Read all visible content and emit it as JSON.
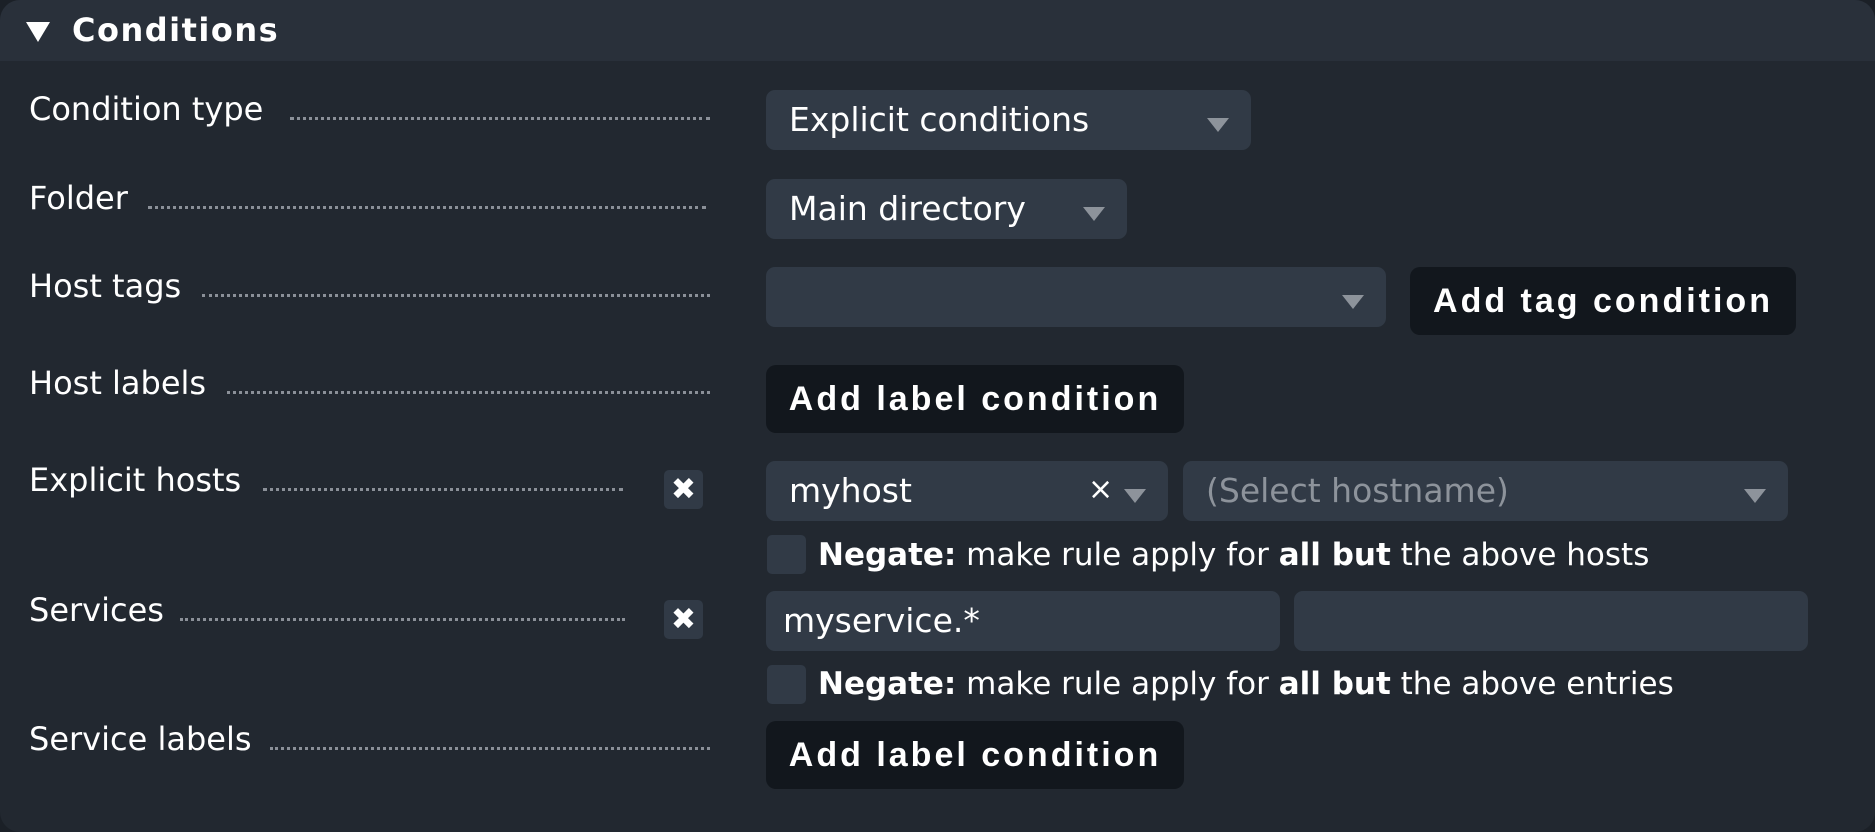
{
  "section": {
    "title": "Conditions",
    "collapse_icon": "triangle-down-icon"
  },
  "rows": {
    "condition_type": {
      "label": "Condition type",
      "selected": "Explicit conditions"
    },
    "folder": {
      "label": "Folder",
      "selected": "Main directory"
    },
    "host_tags": {
      "label": "Host tags",
      "selected": "",
      "button": "Add tag condition"
    },
    "host_labels": {
      "label": "Host labels",
      "button": "Add label condition"
    },
    "explicit_hosts": {
      "label": "Explicit hosts",
      "delete_icon": "✖",
      "host_value": "myhost",
      "clear_icon": "×",
      "hostname_placeholder": "(Select hostname)",
      "negate": {
        "checked": false,
        "bold_prefix": "Negate:",
        "text1": " make rule apply for ",
        "bold_mid": "all but",
        "text2": " the above hosts"
      }
    },
    "services": {
      "label": "Services",
      "delete_icon": "✖",
      "service_value": "myservice.*",
      "second_value": "",
      "negate": {
        "checked": false,
        "bold_prefix": "Negate:",
        "text1": " make rule apply for ",
        "bold_mid": "all but",
        "text2": " the above entries"
      }
    },
    "service_labels": {
      "label": "Service labels",
      "button": "Add label condition"
    }
  }
}
